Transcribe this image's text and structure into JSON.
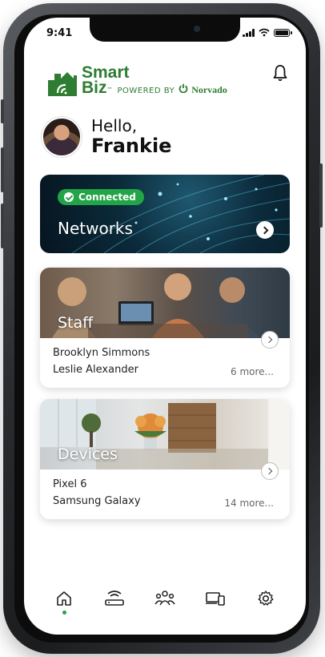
{
  "status": {
    "time": "9:41"
  },
  "brand": {
    "line1": "Smart",
    "line2": "Biz",
    "tm": "™",
    "powered_by": "POWERED BY",
    "partner": "Norvado"
  },
  "greeting": {
    "hello": "Hello,",
    "name": "Frankie"
  },
  "networks": {
    "badge": "Connected",
    "title": "Networks"
  },
  "staff": {
    "title": "Staff",
    "items": [
      "Brooklyn Simmons",
      "Leslie Alexander"
    ],
    "more": "6 more..."
  },
  "devices": {
    "title": "Devices",
    "items": [
      "Pixel 6",
      "Samsung Galaxy"
    ],
    "more": "14 more..."
  },
  "nav": [
    {
      "icon": "home-icon",
      "active": true
    },
    {
      "icon": "router-icon",
      "active": false
    },
    {
      "icon": "people-icon",
      "active": false
    },
    {
      "icon": "devices-icon",
      "active": false
    },
    {
      "icon": "settings-gear-icon",
      "active": false
    }
  ],
  "colors": {
    "brand_green": "#2e7d32",
    "connected_green": "#22a447",
    "active_dot": "#22a447"
  }
}
